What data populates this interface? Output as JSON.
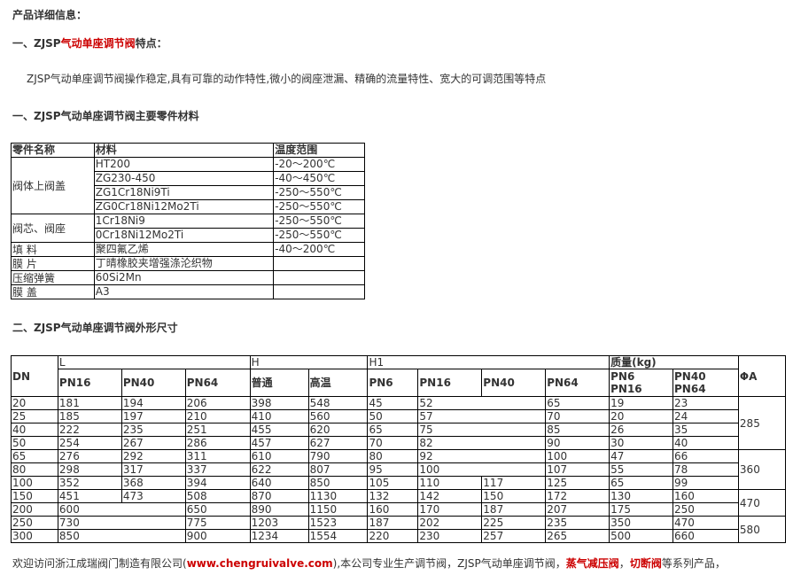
{
  "heading": "产品详细信息：",
  "features": {
    "prefix": "一、ZJSP",
    "link": "气动单座调节阀",
    "suffix": "特点：",
    "text": "ZJSP气动单座调节阀操作稳定,具有可靠的动作特性,微小的阀座泄漏、精确的流量特性、宽大的可调范围等特点"
  },
  "materials_title": "一、ZJSP气动单座调节阀主要零件材料",
  "materials": {
    "headers": [
      "零件名称",
      "材料",
      "温度范围"
    ],
    "groups": [
      {
        "part": "阀体上阀盖",
        "rows": [
          [
            "HT200",
            "-20～200℃"
          ],
          [
            "ZG230-450",
            "-40～450℃"
          ],
          [
            "ZG1Cr18Ni9Ti",
            "-250～550℃"
          ],
          [
            "ZG0Cr18Ni12Mo2Ti",
            "-250～550℃"
          ]
        ]
      },
      {
        "part": "阀芯、阀座",
        "rows": [
          [
            "1Cr18Ni9",
            "-250～550℃"
          ],
          [
            "0Cr18Ni12Mo2Ti",
            "-250～550℃"
          ]
        ]
      },
      {
        "part": "填 料",
        "rows": [
          [
            "聚四氟乙烯",
            "-40～200℃"
          ]
        ]
      },
      {
        "part": "膜 片",
        "rows": [
          [
            "丁晴橡胶夹增强涤沦织物",
            ""
          ]
        ]
      },
      {
        "part": "压缩弹簧",
        "rows": [
          [
            "60Si2Mn",
            ""
          ]
        ]
      },
      {
        "part": "膜 盖",
        "rows": [
          [
            "A3",
            ""
          ]
        ]
      }
    ]
  },
  "dims_title": "二、ZJSP气动单座调节阀外形尺寸",
  "dims": {
    "h1": {
      "dn": "DN",
      "l": "L",
      "h": "H",
      "h1": "H1",
      "mass": "质量(kg)",
      "phia": "ΦA"
    },
    "h2": [
      "PN16",
      "PN40",
      "PN64",
      "普通",
      "高温",
      "PN6",
      "PN16",
      "PN40",
      "PN64",
      "PN6\nPN16",
      "PN40\nPN64"
    ],
    "rows": [
      [
        "20",
        "181",
        "194",
        "206",
        "398",
        "548",
        "45",
        "52",
        "",
        "65",
        "19",
        "23"
      ],
      [
        "25",
        "185",
        "197",
        "210",
        "410",
        "560",
        "50",
        "57",
        "",
        "70",
        "20",
        "24"
      ],
      [
        "40",
        "222",
        "235",
        "251",
        "455",
        "620",
        "65",
        "75",
        "",
        "85",
        "26",
        "35"
      ],
      [
        "50",
        "254",
        "267",
        "286",
        "457",
        "627",
        "70",
        "82",
        "",
        "90",
        "30",
        "40"
      ],
      [
        "65",
        "276",
        "292",
        "311",
        "610",
        "790",
        "80",
        "92",
        "",
        "100",
        "47",
        "66"
      ],
      [
        "80",
        "298",
        "317",
        "337",
        "622",
        "807",
        "95",
        "100",
        "",
        "107",
        "55",
        "78"
      ],
      [
        "100",
        "352",
        "368",
        "394",
        "640",
        "850",
        "105",
        "110",
        "117",
        "125",
        "65",
        "99"
      ],
      [
        "150",
        "451",
        "473",
        "508",
        "870",
        "1130",
        "132",
        "142",
        "150",
        "172",
        "130",
        "160"
      ],
      [
        "200",
        "600",
        "",
        "650",
        "890",
        "1150",
        "160",
        "170",
        "187",
        "207",
        "175",
        "250"
      ],
      [
        "250",
        "730",
        "",
        "775",
        "1203",
        "1523",
        "187",
        "202",
        "225",
        "235",
        "350",
        "470"
      ],
      [
        "300",
        "850",
        "",
        "900",
        "1234",
        "1554",
        "220",
        "230",
        "257",
        "265",
        "500",
        "660"
      ]
    ],
    "phia": [
      "285",
      "360",
      "470",
      "580"
    ]
  },
  "footer": {
    "t1": "欢迎访问浙江成瑞阀门制造有限公司(",
    "url": "www.chengruivalve.com",
    "t2": "),本公司专业生产调节阀，ZJSP气动单座调节阀，",
    "l1": "蒸气减压阀",
    "sep": "，",
    "l2": "切断阀",
    "t3": "等系列产品，"
  }
}
